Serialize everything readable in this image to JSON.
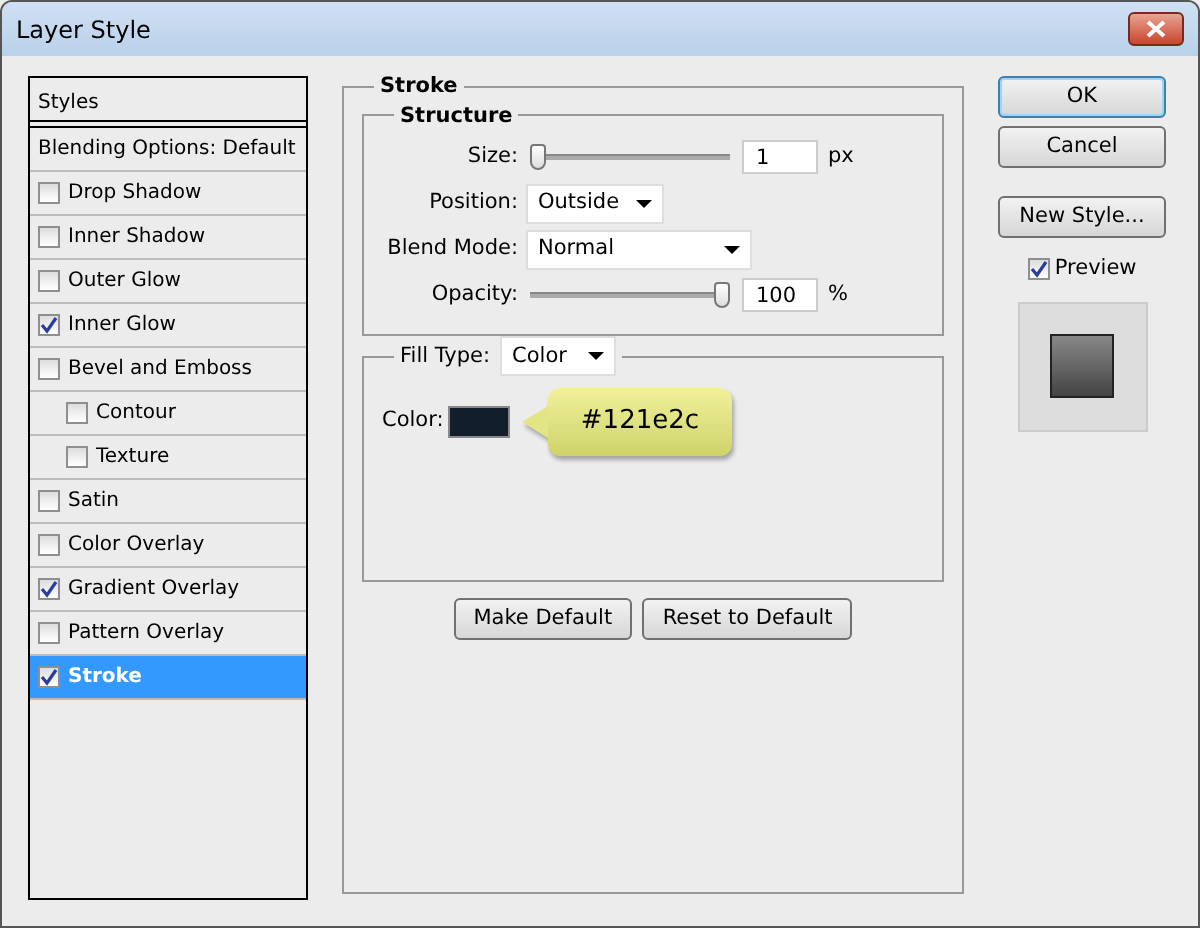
{
  "window": {
    "title": "Layer Style"
  },
  "styles_list": {
    "header": "Styles",
    "items": [
      {
        "kind": "option",
        "label": "Blending Options: Default",
        "selected": false
      },
      {
        "kind": "checkbox",
        "label": "Drop Shadow",
        "checked": false,
        "selected": false
      },
      {
        "kind": "checkbox",
        "label": "Inner Shadow",
        "checked": false,
        "selected": false
      },
      {
        "kind": "checkbox",
        "label": "Outer Glow",
        "checked": false,
        "selected": false
      },
      {
        "kind": "checkbox",
        "label": "Inner Glow",
        "checked": true,
        "selected": false
      },
      {
        "kind": "checkbox",
        "label": "Bevel and Emboss",
        "checked": false,
        "selected": false,
        "children": [
          {
            "kind": "checkbox",
            "label": "Contour",
            "checked": false,
            "selected": false
          },
          {
            "kind": "checkbox",
            "label": "Texture",
            "checked": false,
            "selected": false
          }
        ]
      },
      {
        "kind": "checkbox",
        "label": "Satin",
        "checked": false,
        "selected": false
      },
      {
        "kind": "checkbox",
        "label": "Color Overlay",
        "checked": false,
        "selected": false
      },
      {
        "kind": "checkbox",
        "label": "Gradient Overlay",
        "checked": true,
        "selected": false
      },
      {
        "kind": "checkbox",
        "label": "Pattern Overlay",
        "checked": false,
        "selected": false
      },
      {
        "kind": "checkbox",
        "label": "Stroke",
        "checked": true,
        "selected": true
      }
    ]
  },
  "stroke": {
    "title": "Stroke",
    "structure": {
      "title": "Structure",
      "rows": [
        {
          "kind": "slider",
          "label": "Size:",
          "level": 0,
          "value": "1",
          "unit": "px"
        },
        {
          "kind": "select",
          "label": "Position:",
          "value": "Outside",
          "wide": false
        },
        {
          "kind": "select",
          "label": "Blend Mode:",
          "value": "Normal",
          "wide": true
        },
        {
          "kind": "slider",
          "label": "Opacity:",
          "level": 1,
          "value": "100",
          "unit": "%"
        }
      ]
    },
    "fill": {
      "fill_type_label": "Fill Type:",
      "fill_type": "Color",
      "color_label": "Color:",
      "color": "#121e2c",
      "callout": "#121e2c"
    },
    "buttons": [
      "Make Default",
      "Reset to Default"
    ]
  },
  "actions": [
    {
      "label": "OK",
      "default": true
    },
    {
      "label": "Cancel",
      "default": false
    },
    {
      "label": "New Style...",
      "default": false
    }
  ],
  "preview": {
    "label": "Preview",
    "checked": true
  }
}
